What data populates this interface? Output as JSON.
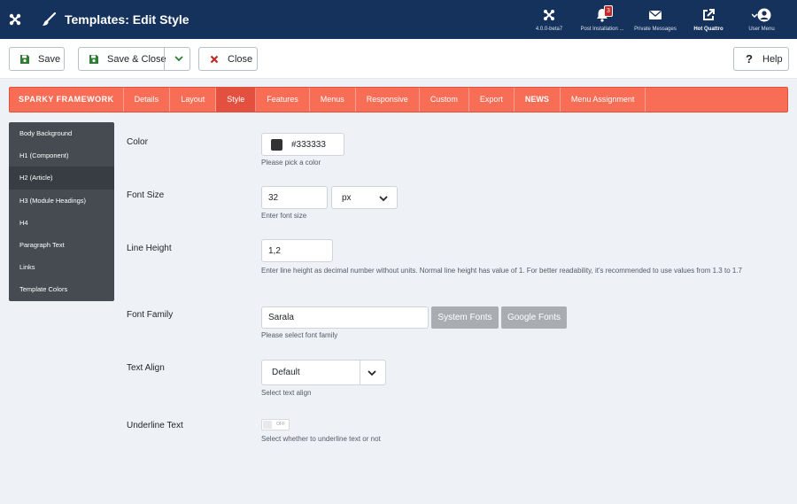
{
  "header": {
    "title": "Templates: Edit Style",
    "actions": [
      {
        "label": "4.0.0-beta7",
        "icon": "joomla-icon"
      },
      {
        "label": "Post Installation ...",
        "icon": "bell-icon",
        "badge": "3"
      },
      {
        "label": "Private Messages",
        "icon": "envelope-icon"
      },
      {
        "label": "Hot Quattro",
        "icon": "external-link-icon"
      },
      {
        "label": "User Menu",
        "icon": "user-icon"
      }
    ]
  },
  "toolbar": {
    "save": "Save",
    "save_close": "Save & Close",
    "close": "Close",
    "help": "Help"
  },
  "tabs": [
    "SPARKY FRAMEWORK",
    "Details",
    "Layout",
    "Style",
    "Features",
    "Menus",
    "Responsive",
    "Custom",
    "Export",
    "NEWS",
    "Menu Assignment"
  ],
  "active_tab": "Style",
  "sidebar": [
    "Body Background",
    "H1 (Component)",
    "H2 (Article)",
    "H3 (Module Headings)",
    "H4",
    "Paragraph Text",
    "Links",
    "Template Colors"
  ],
  "active_sidebar": "H2 (Article)",
  "form": {
    "color": {
      "label": "Color",
      "value": "#333333",
      "help": "Please pick a color"
    },
    "font_size": {
      "label": "Font Size",
      "value": "32",
      "unit": "px",
      "help": "Enter font size"
    },
    "line_height": {
      "label": "Line Height",
      "value": "1,2",
      "help": "Enter line height as decimal number without units. Normal line height has value of 1. For better readability, it's recommended to use values from 1.3 to 1.7"
    },
    "font_family": {
      "label": "Font Family",
      "value": "Sarala",
      "system_btn": "System Fonts",
      "google_btn": "Google Fonts",
      "help": "Please select font family"
    },
    "text_align": {
      "label": "Text Align",
      "value": "Default",
      "help": "Select text align"
    },
    "underline": {
      "label": "Underline Text",
      "state": "OFF",
      "help": "Select whether to underline text or not"
    }
  },
  "colors": {
    "header": "#14325c",
    "tabbar": "#f76d55",
    "sidebar": "#464b52",
    "swatch": "#333333"
  }
}
